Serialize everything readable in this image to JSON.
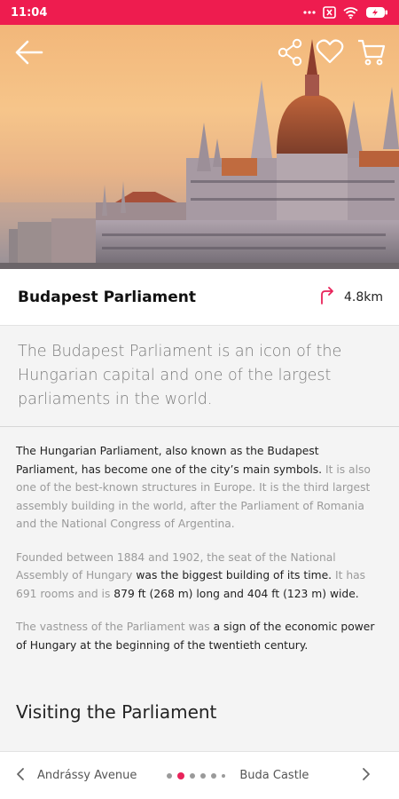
{
  "status_bar": {
    "time": "11:04",
    "icons": [
      "dots-icon",
      "close-box-icon",
      "wifi-icon",
      "battery-icon"
    ],
    "background": "#ee1c4f"
  },
  "header": {
    "icons": [
      "back-arrow-icon",
      "share-icon",
      "heart-icon",
      "cart-icon"
    ]
  },
  "place": {
    "title": "Budapest Parliament",
    "distance": "4.8km",
    "distance_icon": "turn-right-icon",
    "accent": "#e8235a"
  },
  "lead": "The Budapest Parliament is an icon of the Hungarian capital  and one of the largest parliaments in the world.",
  "paragraphs": [
    {
      "segments": [
        {
          "text": "The Hungarian Parliament, also known as the Budapest Parliament, has become one of the city’s main symbols.",
          "emphasis": true
        },
        {
          "text": " It is also one of the best-known structures in Europe. It is the third largest assembly building in the world, after the Parliament of Romania and the National Congress of Argentina.",
          "emphasis": false
        }
      ]
    },
    {
      "segments": [
        {
          "text": "Founded between 1884 and 1902, the seat of the National Assembly of Hungary ",
          "emphasis": false
        },
        {
          "text": "was the biggest building of its time.",
          "emphasis": true
        },
        {
          "text": " It has 691 rooms and is ",
          "emphasis": false
        },
        {
          "text": "879 ft (268 m) long and 404 ft (123 m) wide.",
          "emphasis": true
        }
      ]
    },
    {
      "segments": [
        {
          "text": "The vastness of the Parliament was ",
          "emphasis": false
        },
        {
          "text": "a sign of the economic power of Hungary at the beginning of the twentieth century.",
          "emphasis": true
        }
      ]
    }
  ],
  "section_heading": "Visiting the Parliament",
  "bottom_nav": {
    "prev_label": "Andrássy Avenue",
    "next_label": "Buda Castle",
    "active_dot_color": "#e8235a"
  }
}
